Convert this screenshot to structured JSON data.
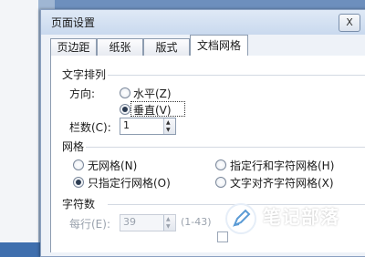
{
  "dialog": {
    "title": "页面设置",
    "close_label": "X",
    "tabs": [
      "页边距",
      "纸张",
      "版式",
      "文档网格"
    ]
  },
  "text_direction": {
    "section_label": "文字排列",
    "direction_label": "方向:",
    "horizontal_label": "水平(Z)",
    "vertical_label": "垂直(V)",
    "columns_label": "栏数(C):",
    "columns_value": "1"
  },
  "grid": {
    "section_label": "网格",
    "no_grid_label": "无网格(N)",
    "lines_only_label": "只指定行网格(O)",
    "lines_and_chars_label": "指定行和字符网格(H)",
    "snap_to_chars_label": "文字对齐字符网格(X)"
  },
  "characters": {
    "section_label": "字符数",
    "per_line_label": "每行(E):",
    "per_line_value": "39",
    "range_label": "(1-43)"
  },
  "watermark": {
    "brand": "笔记部落",
    "url": "www.notetribe.com"
  }
}
